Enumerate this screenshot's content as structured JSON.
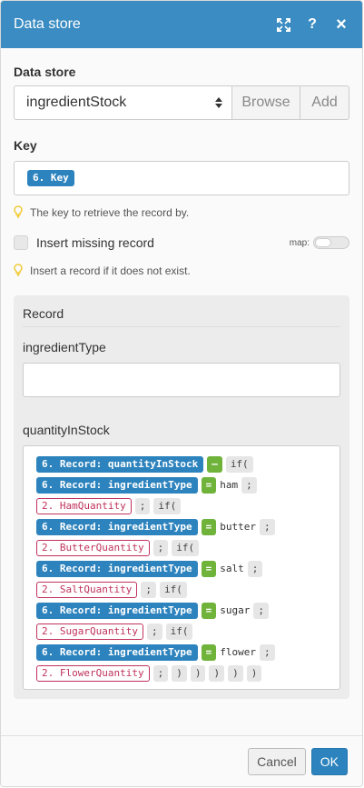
{
  "header": {
    "title": "Data store",
    "icons": [
      "expand-icon",
      "help-icon",
      "close-icon"
    ],
    "help_glyph": "?",
    "close_glyph": "×"
  },
  "data_store": {
    "label": "Data store",
    "selected": "ingredientStock",
    "browse_label": "Browse",
    "add_label": "Add"
  },
  "key": {
    "label": "Key",
    "pill": "6. Key",
    "hint": "The key to retrieve the record by."
  },
  "insert_missing": {
    "label": "Insert missing record",
    "checked": false,
    "map_label": "map:",
    "hint": "Insert a record if it does not exist."
  },
  "record": {
    "title": "Record",
    "ingredient_type_label": "ingredientType",
    "ingredient_type_value": "",
    "quantity_label": "quantityInStock",
    "formula": [
      [
        {
          "t": "blue",
          "v": "6. Record: quantityInStock"
        },
        {
          "t": "green",
          "v": "–"
        },
        {
          "t": "gray",
          "v": "if("
        }
      ],
      [
        {
          "t": "blue",
          "v": "6. Record: ingredientType"
        },
        {
          "t": "green",
          "v": "="
        },
        {
          "t": "text",
          "v": "ham"
        },
        {
          "t": "gray",
          "v": ";"
        }
      ],
      [
        {
          "t": "red",
          "v": "2. HamQuantity"
        },
        {
          "t": "gray",
          "v": ";"
        },
        {
          "t": "gray",
          "v": "if("
        }
      ],
      [
        {
          "t": "blue",
          "v": "6. Record: ingredientType"
        },
        {
          "t": "green",
          "v": "="
        },
        {
          "t": "text",
          "v": "butter"
        },
        {
          "t": "gray",
          "v": ";"
        }
      ],
      [
        {
          "t": "red",
          "v": "2. ButterQuantity"
        },
        {
          "t": "gray",
          "v": ";"
        },
        {
          "t": "gray",
          "v": "if("
        }
      ],
      [
        {
          "t": "blue",
          "v": "6. Record: ingredientType"
        },
        {
          "t": "green",
          "v": "="
        },
        {
          "t": "text",
          "v": "salt"
        },
        {
          "t": "gray",
          "v": ";"
        }
      ],
      [
        {
          "t": "red",
          "v": "2. SaltQuantity"
        },
        {
          "t": "gray",
          "v": ";"
        },
        {
          "t": "gray",
          "v": "if("
        }
      ],
      [
        {
          "t": "blue",
          "v": "6. Record: ingredientType"
        },
        {
          "t": "green",
          "v": "="
        },
        {
          "t": "text",
          "v": "sugar"
        },
        {
          "t": "gray",
          "v": ";"
        }
      ],
      [
        {
          "t": "red",
          "v": "2. SugarQuantity"
        },
        {
          "t": "gray",
          "v": ";"
        },
        {
          "t": "gray",
          "v": "if("
        }
      ],
      [
        {
          "t": "blue",
          "v": "6. Record: ingredientType"
        },
        {
          "t": "green",
          "v": "="
        },
        {
          "t": "text",
          "v": "flower"
        },
        {
          "t": "gray",
          "v": ";"
        }
      ],
      [
        {
          "t": "red",
          "v": "2. FlowerQuantity"
        },
        {
          "t": "gray",
          "v": ";"
        },
        {
          "t": "gray",
          "v": ")"
        },
        {
          "t": "gray",
          "v": ")"
        },
        {
          "t": "gray",
          "v": ")"
        },
        {
          "t": "gray",
          "v": ")"
        },
        {
          "t": "gray",
          "v": ")"
        }
      ]
    ]
  },
  "footer": {
    "cancel_label": "Cancel",
    "ok_label": "OK"
  },
  "colors": {
    "header": "#3a8cc2",
    "pill_blue": "#2d83bd",
    "pill_green": "#6fb33b",
    "pill_red_border": "#c0325d",
    "hint_bulb": "#f0c419"
  }
}
